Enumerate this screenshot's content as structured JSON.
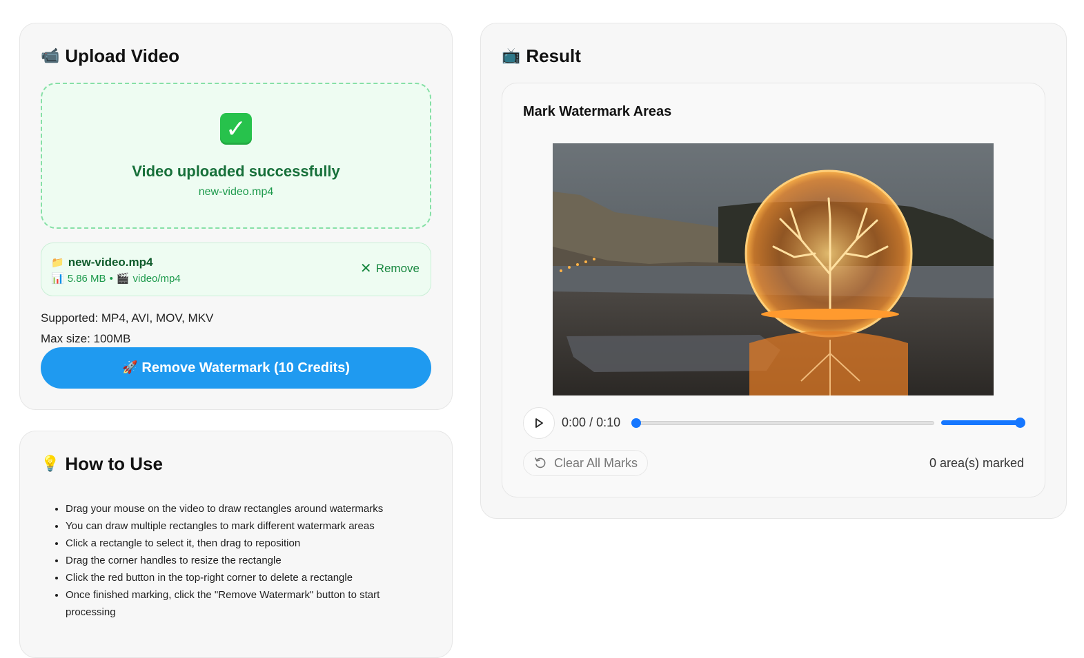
{
  "upload": {
    "title": "Upload Video",
    "title_icon": "video-camera-icon",
    "status": "Video uploaded successfully",
    "filename": "new-video.mp4",
    "file": {
      "name": "new-video.mp4",
      "size": "5.86 MB",
      "separator": "•",
      "type": "video/mp4",
      "remove_label": "Remove"
    },
    "supported": "Supported: MP4, AVI, MOV, MKV",
    "max_size": "Max size: 100MB",
    "process_button": "Remove Watermark (10 Credits)"
  },
  "howto": {
    "title": "How to Use",
    "title_icon": "lightbulb-icon",
    "steps": [
      "Drag your mouse on the video to draw rectangles around watermarks",
      "You can draw multiple rectangles to mark different watermark areas",
      "Click a rectangle to select it, then drag to reposition",
      "Drag the corner handles to resize the rectangle",
      "Click the red button in the top-right corner to delete a rectangle",
      "Once finished marking, click the \"Remove Watermark\" button to start processing"
    ]
  },
  "result": {
    "title": "Result",
    "title_icon": "television-icon",
    "editor_title": "Mark Watermark Areas",
    "player": {
      "current_time": "0:00",
      "time_separator": "/",
      "duration": "0:10",
      "progress": 0,
      "volume": 1
    },
    "clear_button": "Clear All Marks",
    "marked_count": "0 area(s) marked"
  },
  "colors": {
    "accent": "#1f9af0",
    "success": "#17703a",
    "player_blue": "#1677ff"
  }
}
